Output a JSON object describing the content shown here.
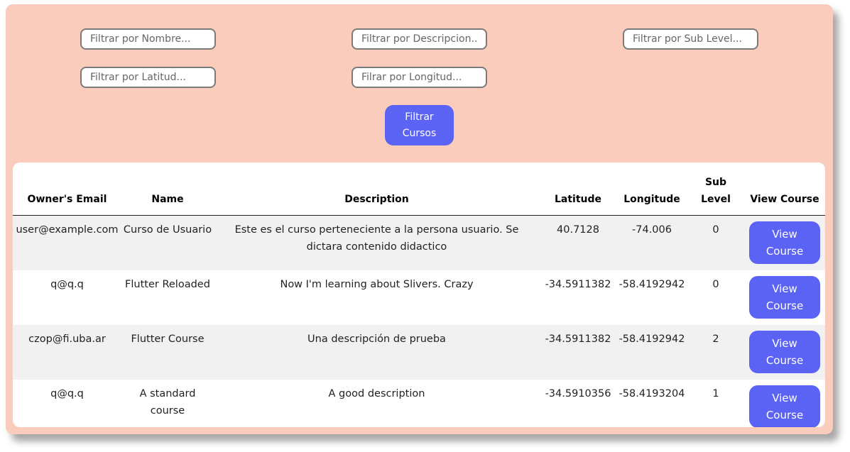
{
  "filters": {
    "nombre_placeholder": "Filtrar por Nombre...",
    "descripcion_placeholder": "Filtrar por Descripcion..",
    "sublevel_placeholder": "Filtrar por Sub Level...",
    "latitud_placeholder": "Filtrar por Latitud...",
    "longitud_placeholder": "Filrar por Longitud..."
  },
  "filter_button": {
    "label": "Filtrar Cursos"
  },
  "table": {
    "headers": {
      "email": "Owner's Email",
      "name": "Name",
      "description": "Description",
      "latitude": "Latitude",
      "longitude": "Longitude",
      "sub_level": "Sub Level",
      "view": "View Course"
    },
    "rows": [
      {
        "email": "user@example.com",
        "name": "Curso de Usuario",
        "description": "Este es el curso perteneciente a la persona usuario. Se dictara contenido didactico",
        "latitude": "40.7128",
        "longitude": "-74.006",
        "sub_level": "0",
        "button": "View Course"
      },
      {
        "email": "q@q.q",
        "name": "Flutter Reloaded",
        "description": "Now I'm learning about Slivers. Crazy",
        "latitude": "-34.5911382",
        "longitude": "-58.4192942",
        "sub_level": "0",
        "button": "View Course"
      },
      {
        "email": "czop@fi.uba.ar",
        "name": "Flutter Course",
        "description": "Una descripción de prueba",
        "latitude": "-34.5911382",
        "longitude": "-58.4192942",
        "sub_level": "2",
        "button": "View Course"
      },
      {
        "email": "q@q.q",
        "name": "A standard course",
        "description": "A good description",
        "latitude": "-34.5910356",
        "longitude": "-58.4193204",
        "sub_level": "1",
        "button": "View Course"
      }
    ]
  },
  "colors": {
    "panel_background": "#f9ccbc",
    "accent_button": "#5b63f5",
    "alt_row": "#f1f1f1"
  }
}
